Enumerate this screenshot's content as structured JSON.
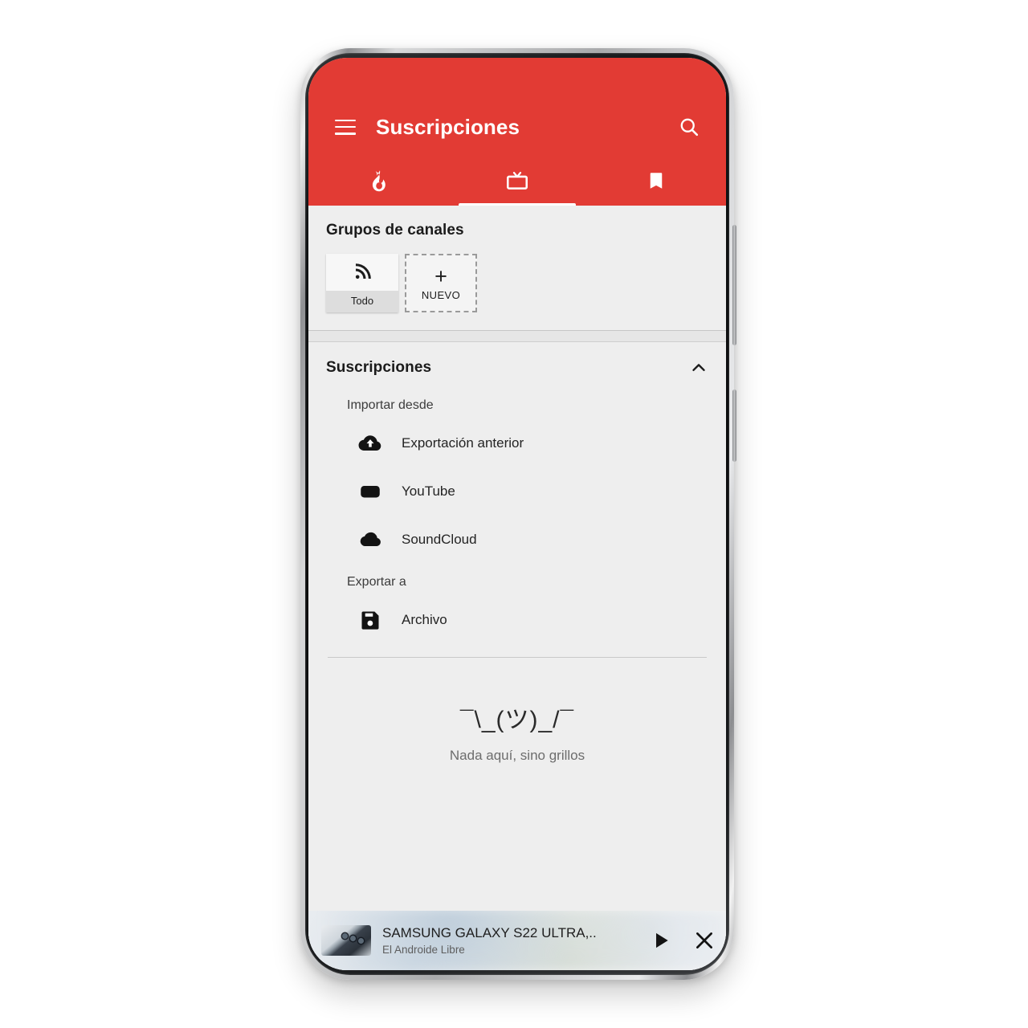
{
  "app": {
    "accent_color": "#e23b34",
    "screen_background": "#eeeeee",
    "title": "Suscripciones"
  },
  "appbar": {
    "menu_icon": "hamburger-menu-icon",
    "title": "Suscripciones",
    "search_icon": "search-icon"
  },
  "tabs": [
    {
      "icon": "trending-flame-icon",
      "name": "trending",
      "selected": false
    },
    {
      "icon": "tv-subscriptions-icon",
      "name": "subscriptions",
      "selected": true
    },
    {
      "icon": "bookmark-icon",
      "name": "bookmarks",
      "selected": false
    }
  ],
  "channel_groups": {
    "title": "Grupos de canales",
    "cards": [
      {
        "icon": "rss-feed-icon",
        "label": "Todo",
        "style": "filled"
      },
      {
        "icon": "plus-icon",
        "label": "NUEVO",
        "plus": "+",
        "style": "dashed"
      }
    ]
  },
  "subscriptions": {
    "title": "Suscripciones",
    "collapse_icon": "chevron-up-icon",
    "import_header": "Importar desde",
    "import_items": [
      {
        "icon": "cloud-upload-icon",
        "label": "Exportación anterior"
      },
      {
        "icon": "youtube-icon",
        "label": "YouTube"
      },
      {
        "icon": "soundcloud-cloud-icon",
        "label": "SoundCloud"
      }
    ],
    "export_header": "Exportar a",
    "export_items": [
      {
        "icon": "floppy-save-icon",
        "label": "Archivo"
      }
    ]
  },
  "empty_state": {
    "kaomoji": "¯\\_(ツ)_/¯",
    "message": "Nada aquí, sino grillos"
  },
  "miniplayer": {
    "thumbnail": "video-thumbnail",
    "title": "SAMSUNG GALAXY S22 ULTRA,..",
    "uploader": "El Androide Libre",
    "play_icon": "play-icon",
    "close_icon": "close-icon"
  }
}
